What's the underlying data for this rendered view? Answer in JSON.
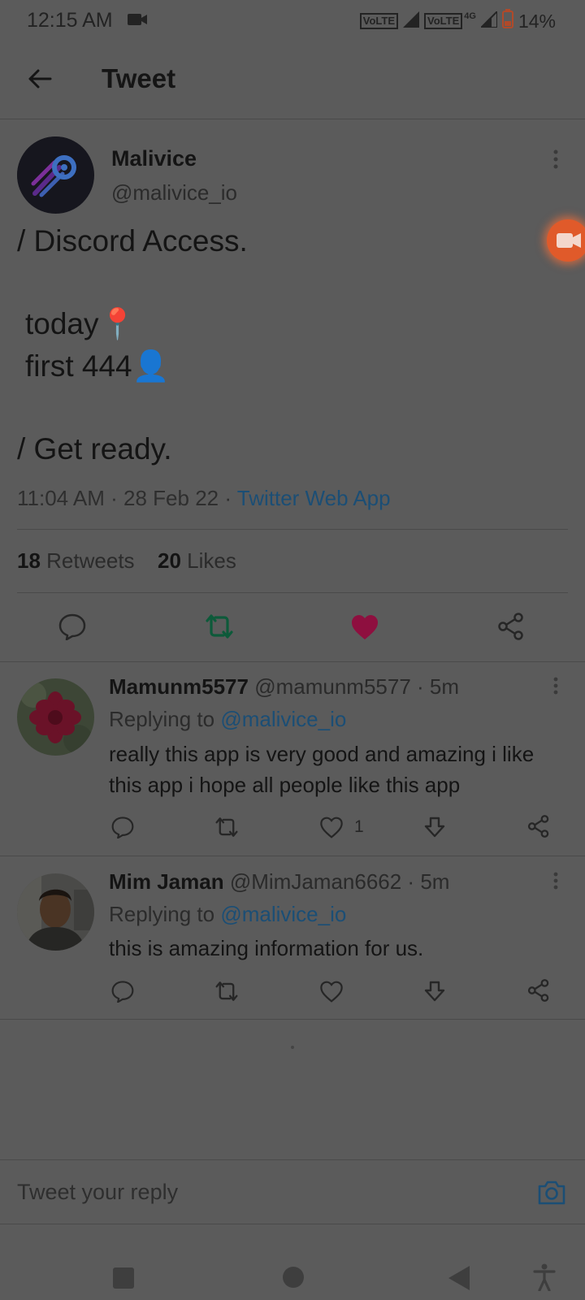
{
  "status_bar": {
    "time": "12:15 AM",
    "volte1": "VoLTE",
    "volte2": "VoLTE",
    "network": "4G",
    "battery": "14%"
  },
  "header": {
    "title": "Tweet"
  },
  "tweet": {
    "author_name": "Malivice",
    "author_handle": "@malivice_io",
    "lines": [
      "/ Discord Access.",
      "today📍",
      "first 444👤",
      "/ Get ready."
    ],
    "time": "11:04 AM · 28 Feb 22 · ",
    "source": "Twitter Web App",
    "retweets_count": "18",
    "retweets_label": "Retweets",
    "likes_count": "20",
    "likes_label": "Likes"
  },
  "replies": [
    {
      "name": "Mamunm5577",
      "handle": "@mamunm5577 · 5m",
      "replying_prefix": "Replying to ",
      "replying_handle": "@malivice_io",
      "text": "really this app is very good and amazing i like this app i hope all people like this app",
      "likes": "1"
    },
    {
      "name": "Mim Jaman",
      "handle": "@MimJaman6662 · 5m",
      "replying_prefix": "Replying to ",
      "replying_handle": "@malivice_io",
      "text": "this is amazing information for us.",
      "likes": ""
    }
  ],
  "compose": {
    "placeholder": "Tweet your reply"
  },
  "colors": {
    "accent": "#1b4e75",
    "like": "#8e0f3f",
    "retweet": "#0d5a3a",
    "record": "#e05a2a"
  }
}
